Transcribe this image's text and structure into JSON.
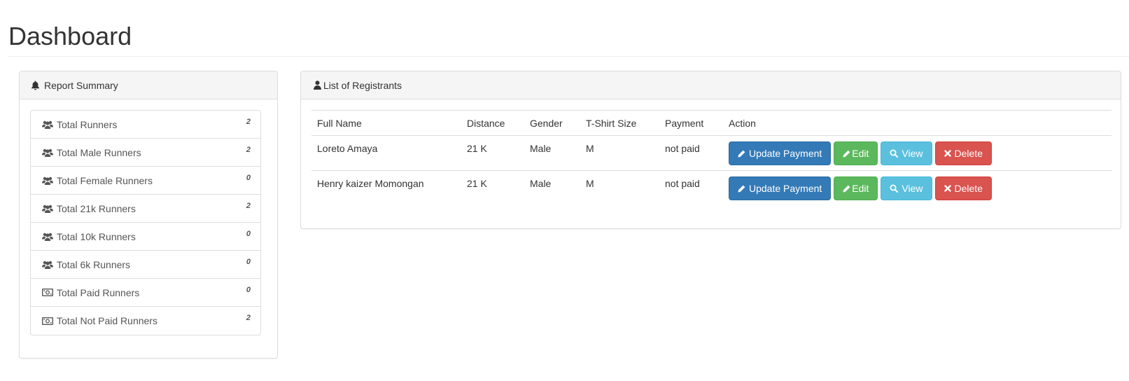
{
  "page": {
    "title": "Dashboard"
  },
  "summary": {
    "heading": "Report Summary",
    "items": [
      {
        "label": "Total Runners",
        "count": "2",
        "icon": "users-icon"
      },
      {
        "label": "Total Male Runners",
        "count": "2",
        "icon": "users-icon"
      },
      {
        "label": "Total Female Runners",
        "count": "0",
        "icon": "users-icon"
      },
      {
        "label": "Total 21k Runners",
        "count": "2",
        "icon": "users-icon"
      },
      {
        "label": "Total 10k Runners",
        "count": "0",
        "icon": "users-icon"
      },
      {
        "label": "Total 6k Runners",
        "count": "0",
        "icon": "users-icon"
      },
      {
        "label": "Total Paid Runners",
        "count": "0",
        "icon": "money-icon"
      },
      {
        "label": "Total Not Paid Runners",
        "count": "2",
        "icon": "money-icon"
      }
    ]
  },
  "registrants": {
    "heading": "List of Registrants",
    "columns": [
      "Full Name",
      "Distance",
      "Gender",
      "T-Shirt Size",
      "Payment",
      "Action"
    ],
    "rows": [
      {
        "name": "Loreto Amaya",
        "distance": "21 K",
        "gender": "Male",
        "size": "M",
        "payment": "not paid"
      },
      {
        "name": "Henry kaizer Momongan",
        "distance": "21 K",
        "gender": "Male",
        "size": "M",
        "payment": "not paid"
      }
    ],
    "actions": {
      "update_payment": "Update Payment",
      "edit": "Edit",
      "view": "View",
      "delete": "Delete"
    }
  },
  "colors": {
    "primary": "#337ab7",
    "success": "#5cb85c",
    "info": "#5bc0de",
    "danger": "#d9534f"
  }
}
